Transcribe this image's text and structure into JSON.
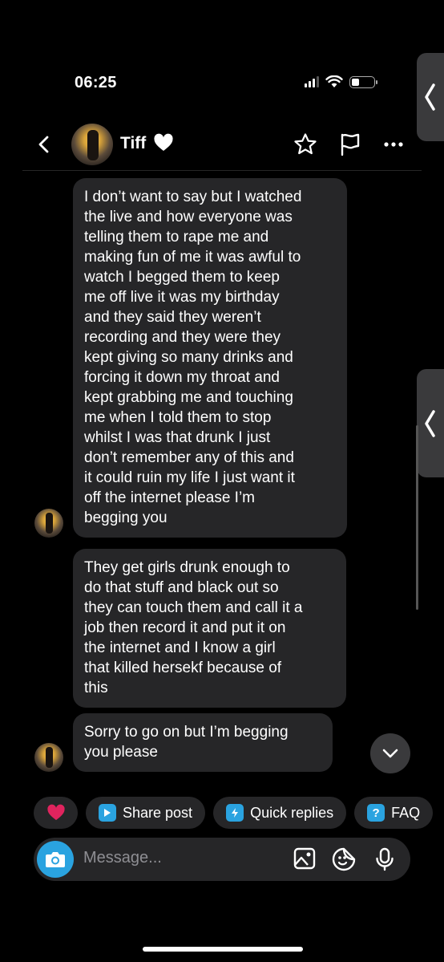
{
  "status_bar": {
    "time": "06:25"
  },
  "header": {
    "contact_name": "Tiff"
  },
  "messages": [
    {
      "text": "I don’t want to say but I watched\nthe live and how everyone was\ntelling them to rape me and\nmaking fun of me it was awful to\nwatch I begged them to keep\nme off live it was my birthday\nand they said they weren’t\nrecording and they were they\nkept giving so many drinks and\nforcing it down my throat and\nkept grabbing me and touching\nme when I told them to stop\nwhilst I was that drunk  I just\ndon’t remember any of this and\nit could ruin my life I just want it\noff the internet please I’m\nbegging you"
    },
    {
      "text": "They get girls drunk enough to\ndo that stuff and black out so\nthey can touch them and call it a\njob then record it and put it on\nthe internet and I know a girl\nthat killed hersekf because of\nthis"
    },
    {
      "text": "Sorry to go on but I’m begging\nyou please"
    }
  ],
  "quick_actions": {
    "share_post": "Share post",
    "quick_replies": "Quick replies",
    "faq": "FAQ"
  },
  "composer": {
    "placeholder": "Message..."
  },
  "colors": {
    "accent": "#2aa3e0",
    "bubble": "#262628",
    "heart": "#e0245e"
  },
  "icons": [
    "back-icon",
    "heart-icon",
    "star-icon",
    "flag-icon",
    "more-icon",
    "chevron-down-icon",
    "camera-icon",
    "image-icon",
    "sticker-icon",
    "mic-icon"
  ]
}
